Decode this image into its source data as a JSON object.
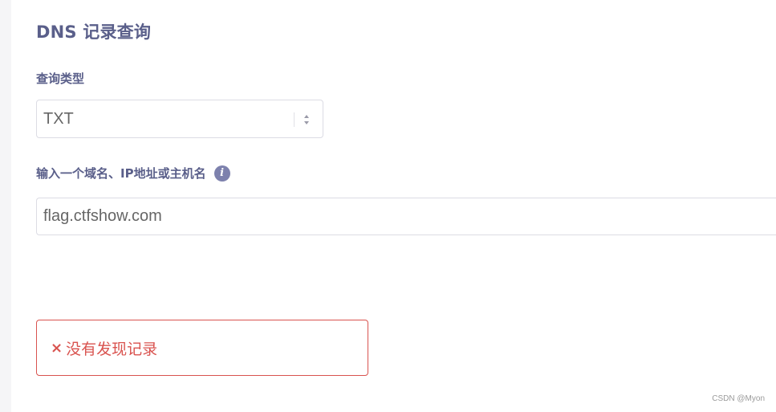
{
  "title": "DNS 记录查询",
  "query_type": {
    "label": "查询类型",
    "selected": "TXT"
  },
  "domain_input": {
    "label": "输入一个域名、IP地址或主机名",
    "info_icon": "i",
    "value": "flag.ctfshow.com"
  },
  "result": {
    "icon": "×",
    "message": "没有发现记录"
  },
  "watermark": "CSDN @Myon⁠⁠",
  "colors": {
    "heading": "#5a5f8a",
    "error": "#d9534f",
    "info_icon": "#7d81ad"
  }
}
